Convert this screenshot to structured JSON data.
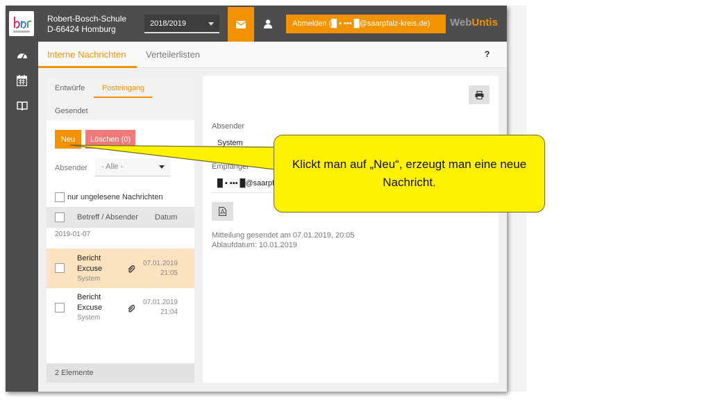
{
  "header": {
    "school_name": "Robert-Bosch-Schule",
    "school_address": "D-66424 Homburg",
    "school_year": "2018/2019",
    "logout_label": "Abmelden (█ ▪ ▪▪▪ █@saarpfalz-kreis.de)",
    "brand_web": "Web",
    "brand_untis": "Untis",
    "accent_color": "#f39200"
  },
  "sidebar": {
    "icons": [
      "dashboard-icon",
      "calendar-icon",
      "book-icon"
    ]
  },
  "tabs": [
    {
      "label": "Interne Nachrichten",
      "active": true
    },
    {
      "label": "Verteilerlisten",
      "active": false
    }
  ],
  "help_label": "?",
  "messages_panel": {
    "subtabs": [
      {
        "label": "Entwürfe",
        "active": false
      },
      {
        "label": "Posteingang",
        "active": true
      },
      {
        "label": "Gesendet",
        "active": false
      }
    ],
    "new_button": "Neu",
    "delete_button": "Löschen (0)",
    "sender_filter_label": "Absender",
    "sender_filter_value": "- Alle -",
    "unread_only_label": "nur ungelesene Nachrichten",
    "columns": [
      "Betreff / Absender",
      "Datum"
    ],
    "group_date": "2019-01-07",
    "rows": [
      {
        "title_line1": "Bericht",
        "title_line2": "Excuse",
        "sender": "System",
        "date": "07.01.2019",
        "time": "21:05",
        "selected": true
      },
      {
        "title_line1": "Bericht",
        "title_line2": "Excuse",
        "sender": "System",
        "date": "07.01.2019",
        "time": "21:04",
        "selected": false
      }
    ],
    "footer": "2 Elemente"
  },
  "detail": {
    "sender_label": "Absender",
    "sender_value": "System",
    "recipient_label": "Empfänger",
    "recipient_value": "█ ▪ ▪▪▪ █@saarpfalz-kreis.de",
    "sent_info": "Mitteilung gesendet am 07.01.2019, 20:05",
    "expiry_info": "Ablaufdatum: 10.01.2019"
  },
  "callout": {
    "text": "Klickt man auf „Neu“, erzeugt man eine neue Nachricht.",
    "color": "#fff200"
  }
}
